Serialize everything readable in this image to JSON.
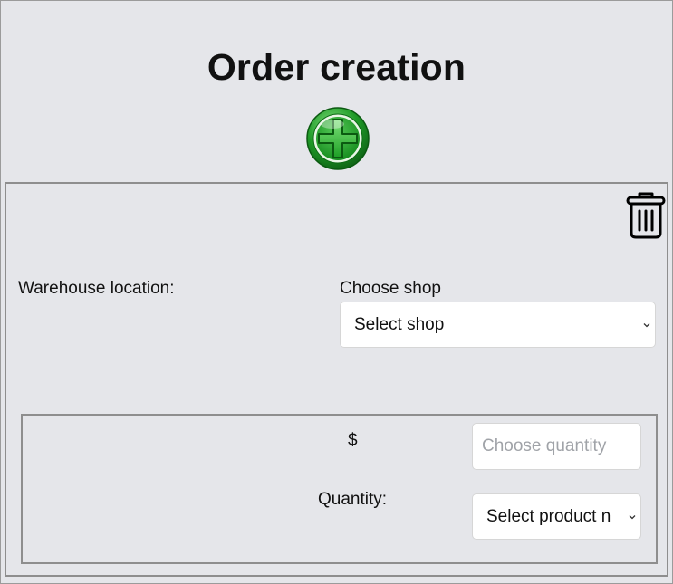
{
  "page": {
    "title": "Order creation"
  },
  "icons": {
    "add": "add-order-plus-icon",
    "delete": "trash-icon",
    "dropdown": "chevron-down-icon"
  },
  "colors": {
    "background": "#e5e6ea",
    "add_button_green": "#1f9a27",
    "border": "#8e8e8e"
  },
  "order": {
    "warehouse_label": "Warehouse location:",
    "shop_label": "Choose shop",
    "shop_select": {
      "selected": "Select shop"
    },
    "product": {
      "price_text": "$",
      "quantity_input": {
        "placeholder": "Choose quantity",
        "value": ""
      },
      "quantity_label": "Quantity:",
      "product_select": {
        "selected": "Select product n"
      }
    }
  }
}
